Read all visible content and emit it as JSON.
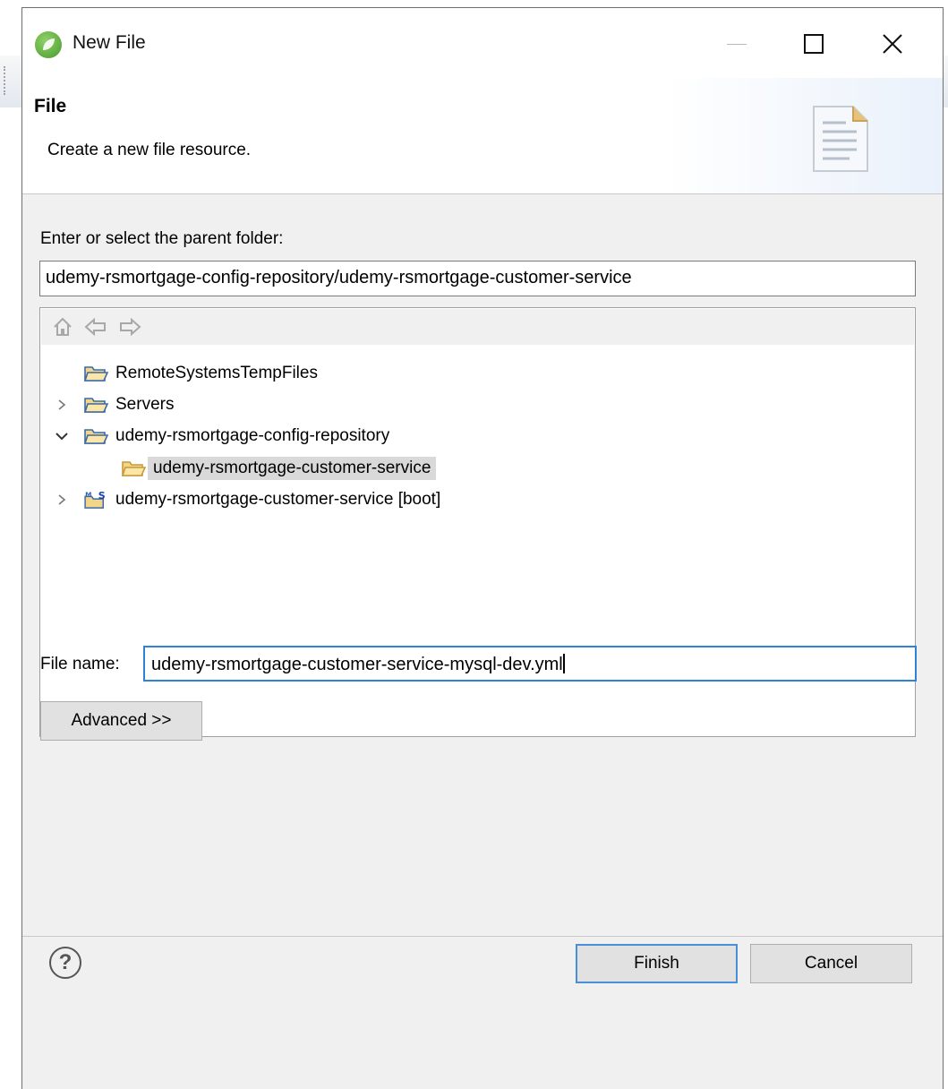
{
  "window": {
    "title": "New File",
    "app_icon": "spring-leaf-icon",
    "controls": [
      "minimize-icon",
      "maximize-icon",
      "close-icon"
    ]
  },
  "banner": {
    "title": "File",
    "description": "Create a new file resource.",
    "icon": "document-icon"
  },
  "parent_folder": {
    "label": "Enter or select the parent folder:",
    "value": "udemy-rsmortgage-config-repository/udemy-rsmortgage-customer-service"
  },
  "tree": {
    "toolbar_icons": [
      "home-icon",
      "back-arrow-icon",
      "forward-arrow-icon"
    ],
    "items": [
      {
        "label": "RemoteSystemsTempFiles",
        "expander": "none",
        "icon": "folder-icon",
        "selected": false
      },
      {
        "label": "Servers",
        "expander": "collapsed",
        "icon": "folder-icon",
        "selected": false
      },
      {
        "label": "udemy-rsmortgage-config-repository",
        "expander": "expanded",
        "icon": "folder-icon",
        "selected": false
      },
      {
        "label": "udemy-rsmortgage-customer-service",
        "expander": "none",
        "icon": "folder-icon",
        "selected": true
      },
      {
        "label": "udemy-rsmortgage-customer-service [boot]",
        "expander": "collapsed",
        "icon": "spring-boot-project-icon",
        "selected": false
      }
    ]
  },
  "file_name": {
    "label": "File name:",
    "value": "udemy-rsmortgage-customer-service-mysql-dev.yml"
  },
  "buttons": {
    "advanced": "Advanced >>",
    "finish": "Finish",
    "cancel": "Cancel",
    "help": "?"
  },
  "colors": {
    "focus_border": "#2e83d6",
    "selection": "#d9d9d9",
    "folder": "#e8b84a"
  }
}
